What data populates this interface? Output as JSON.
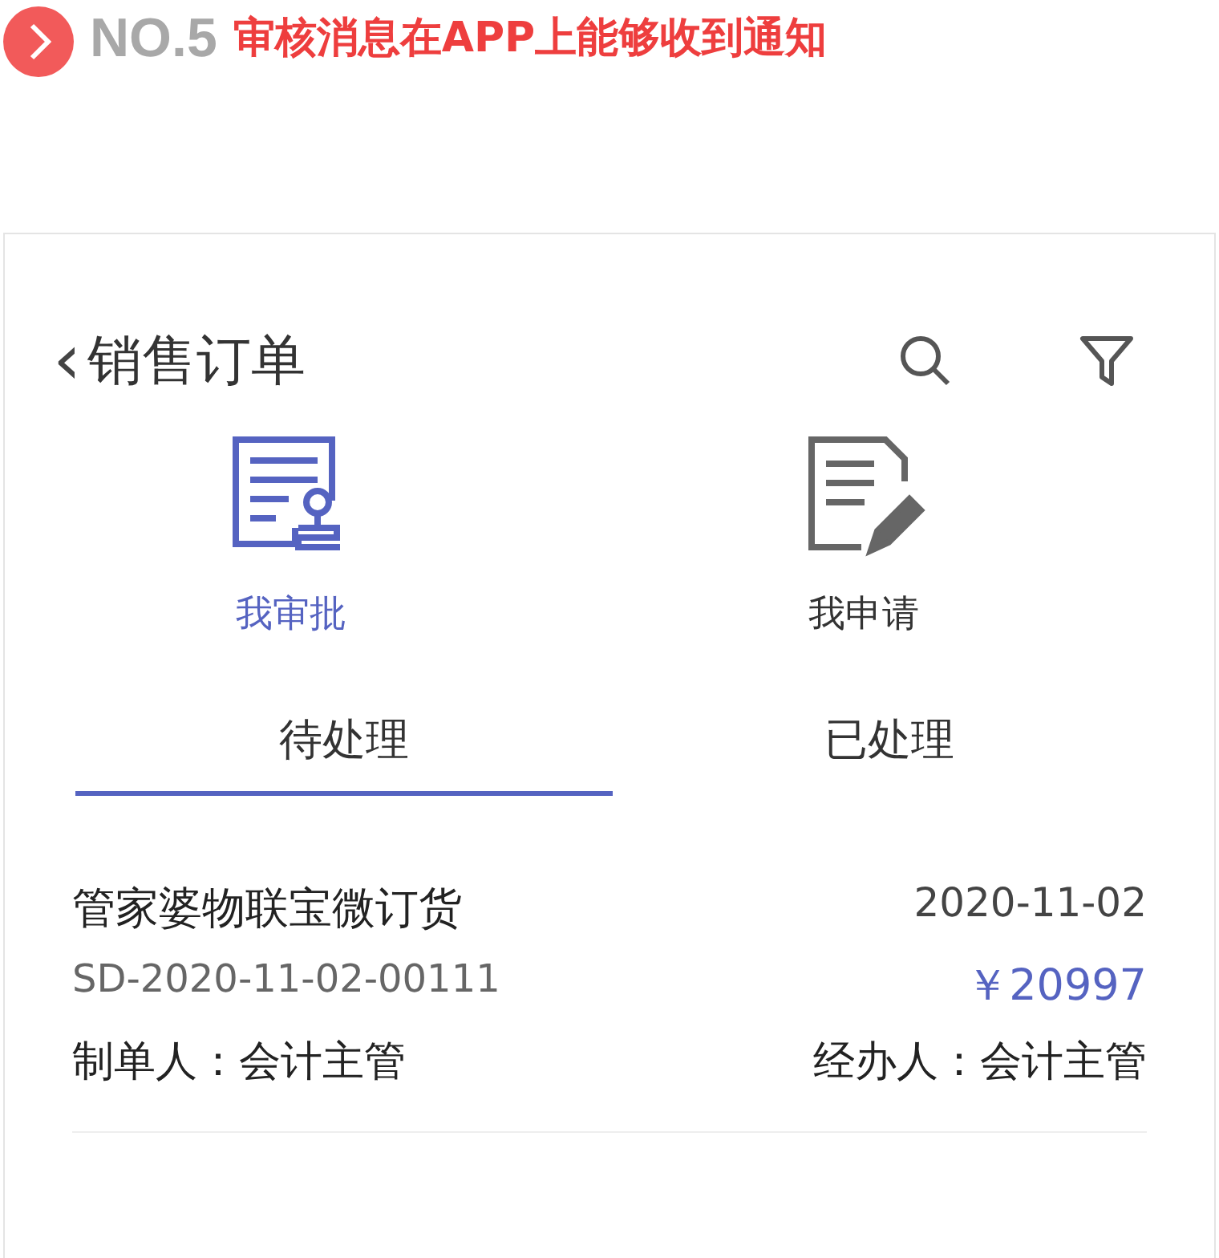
{
  "banner": {
    "number": "NO.5",
    "title": "审核消息在APP上能够收到通知"
  },
  "app": {
    "back": "‹",
    "title": "销售订单",
    "modes": [
      {
        "label": "我审批",
        "kind": "stamp",
        "selected": true
      },
      {
        "label": "我申请",
        "kind": "pencil",
        "selected": false
      }
    ],
    "tabs": [
      {
        "label": "待处理",
        "selected": true
      },
      {
        "label": "已处理",
        "selected": false
      }
    ],
    "orders": [
      {
        "name": "管家婆物联宝微订货",
        "date": "2020-11-02",
        "code": "SD-2020-11-02-00111",
        "amount": "￥20997",
        "maker": "制单人：会计主管",
        "handler": "经办人：会计主管"
      }
    ]
  }
}
